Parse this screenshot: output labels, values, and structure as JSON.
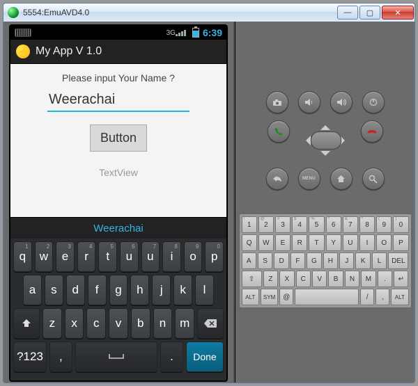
{
  "window": {
    "title": "5554:EmuAVD4.0"
  },
  "statusbar": {
    "network": "3G",
    "clock": "6:39"
  },
  "appbar": {
    "icon_glyph": "⚡",
    "title": "My App V 1.0"
  },
  "app": {
    "prompt": "Please input Your Name ?",
    "input_value": "Weerachai",
    "button_label": "Button",
    "textview": "TextView",
    "suggestion": "Weerachai"
  },
  "phone_kbd": {
    "row1": [
      {
        "k": "q",
        "s": "1"
      },
      {
        "k": "w",
        "s": "2"
      },
      {
        "k": "e",
        "s": "3"
      },
      {
        "k": "r",
        "s": "4"
      },
      {
        "k": "t",
        "s": "5"
      },
      {
        "k": "u",
        "s": "6"
      },
      {
        "k": "u",
        "s": "7"
      },
      {
        "k": "i",
        "s": "8"
      },
      {
        "k": "o",
        "s": "9"
      },
      {
        "k": "p",
        "s": "0"
      }
    ],
    "row2": [
      "a",
      "s",
      "d",
      "f",
      "g",
      "h",
      "j",
      "k",
      "l"
    ],
    "row3": [
      "z",
      "x",
      "c",
      "v",
      "b",
      "n",
      "m"
    ],
    "mode_key": "?123",
    "done_key": "Done",
    "comma": ",",
    "period": "."
  },
  "hw": {
    "menu_label": "MENU"
  },
  "host_kbd": {
    "row0": [
      {
        "t": "1",
        "s": "!"
      },
      {
        "t": "2",
        "s": "@"
      },
      {
        "t": "3",
        "s": "#"
      },
      {
        "t": "4",
        "s": "$"
      },
      {
        "t": "5",
        "s": "%"
      },
      {
        "t": "6",
        "s": "^"
      },
      {
        "t": "7",
        "s": "&"
      },
      {
        "t": "8",
        "s": "*"
      },
      {
        "t": "9",
        "s": "("
      },
      {
        "t": "0",
        "s": ")"
      }
    ],
    "row1": [
      "Q",
      "W",
      "E",
      "R",
      "T",
      "Y",
      "U",
      "I",
      "O",
      "P"
    ],
    "row2": [
      "A",
      "S",
      "D",
      "F",
      "G",
      "H",
      "J",
      "K",
      "L"
    ],
    "row2_del": "DEL",
    "row3": [
      "Z",
      "X",
      "C",
      "V",
      "B",
      "N",
      "M",
      ".",
      "↵"
    ],
    "shift": "⇧",
    "alt": "ALT",
    "sym": "SYM",
    "at": "@",
    "slash": "/",
    "comma": ","
  }
}
